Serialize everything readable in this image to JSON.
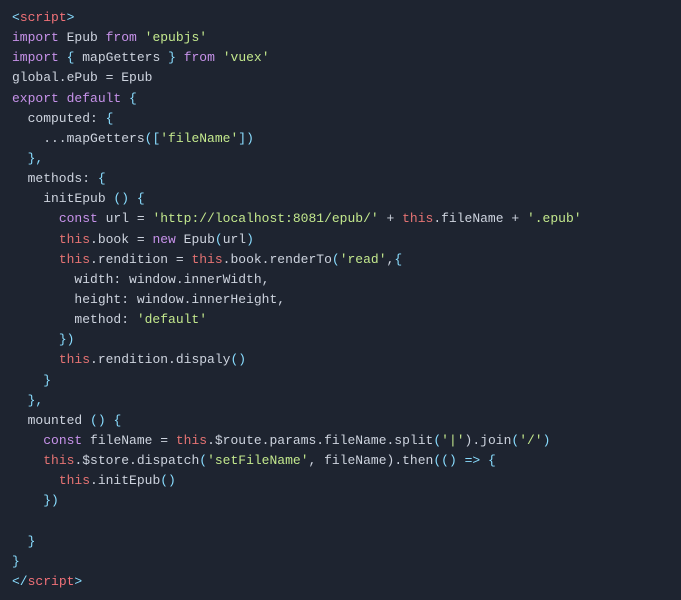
{
  "code": {
    "lines": [
      {
        "tokens": [
          {
            "t": "tag-bracket",
            "v": "<"
          },
          {
            "t": "tag",
            "v": "script"
          },
          {
            "t": "tag-bracket",
            "v": ">"
          }
        ]
      },
      {
        "tokens": [
          {
            "t": "kw",
            "v": "import"
          },
          {
            "t": "plain",
            "v": " Epub "
          },
          {
            "t": "kw",
            "v": "from"
          },
          {
            "t": "plain",
            "v": " "
          },
          {
            "t": "str",
            "v": "'epubjs'"
          }
        ]
      },
      {
        "tokens": [
          {
            "t": "kw",
            "v": "import"
          },
          {
            "t": "plain",
            "v": " "
          },
          {
            "t": "punct",
            "v": "{"
          },
          {
            "t": "plain",
            "v": " mapGetters "
          },
          {
            "t": "punct",
            "v": "}"
          },
          {
            "t": "plain",
            "v": " "
          },
          {
            "t": "kw",
            "v": "from"
          },
          {
            "t": "plain",
            "v": " "
          },
          {
            "t": "str",
            "v": "'vuex'"
          }
        ]
      },
      {
        "tokens": [
          {
            "t": "plain",
            "v": "global.ePub = Epub"
          }
        ]
      },
      {
        "tokens": [
          {
            "t": "kw",
            "v": "export"
          },
          {
            "t": "plain",
            "v": " "
          },
          {
            "t": "kw",
            "v": "default"
          },
          {
            "t": "plain",
            "v": " "
          },
          {
            "t": "punct",
            "v": "{"
          }
        ]
      },
      {
        "tokens": [
          {
            "t": "plain",
            "v": "  computed: "
          },
          {
            "t": "punct",
            "v": "{"
          }
        ]
      },
      {
        "tokens": [
          {
            "t": "plain",
            "v": "    ...mapGetters"
          },
          {
            "t": "punct",
            "v": "("
          },
          {
            "t": "punct",
            "v": "["
          },
          {
            "t": "str",
            "v": "'fileName'"
          },
          {
            "t": "punct",
            "v": "]"
          },
          {
            "t": "punct",
            "v": ")"
          }
        ]
      },
      {
        "tokens": [
          {
            "t": "plain",
            "v": "  "
          },
          {
            "t": "punct",
            "v": "},"
          }
        ]
      },
      {
        "tokens": [
          {
            "t": "plain",
            "v": "  methods: "
          },
          {
            "t": "punct",
            "v": "{"
          }
        ]
      },
      {
        "tokens": [
          {
            "t": "plain",
            "v": "    initEpub "
          },
          {
            "t": "punct",
            "v": "()"
          },
          {
            "t": "plain",
            "v": " "
          },
          {
            "t": "punct",
            "v": "{"
          }
        ]
      },
      {
        "tokens": [
          {
            "t": "plain",
            "v": "      "
          },
          {
            "t": "kw",
            "v": "const"
          },
          {
            "t": "plain",
            "v": " url = "
          },
          {
            "t": "str",
            "v": "'http://localhost:8081/epub/'"
          },
          {
            "t": "plain",
            "v": " + "
          },
          {
            "t": "this-kw",
            "v": "this"
          },
          {
            "t": "plain",
            "v": ".fileName + "
          },
          {
            "t": "str",
            "v": "'.epub'"
          }
        ]
      },
      {
        "tokens": [
          {
            "t": "plain",
            "v": "      "
          },
          {
            "t": "this-kw",
            "v": "this"
          },
          {
            "t": "plain",
            "v": ".book = "
          },
          {
            "t": "kw",
            "v": "new"
          },
          {
            "t": "plain",
            "v": " Epub"
          },
          {
            "t": "punct",
            "v": "("
          },
          {
            "t": "plain",
            "v": "url"
          },
          {
            "t": "punct",
            "v": ")"
          }
        ]
      },
      {
        "tokens": [
          {
            "t": "plain",
            "v": "      "
          },
          {
            "t": "this-kw",
            "v": "this"
          },
          {
            "t": "plain",
            "v": ".rendition = "
          },
          {
            "t": "this-kw",
            "v": "this"
          },
          {
            "t": "plain",
            "v": ".book.renderTo"
          },
          {
            "t": "punct",
            "v": "("
          },
          {
            "t": "str",
            "v": "'read'"
          },
          {
            "t": "plain",
            "v": ","
          },
          {
            "t": "punct",
            "v": "{"
          }
        ]
      },
      {
        "tokens": [
          {
            "t": "plain",
            "v": "        width: window.innerWidth,"
          }
        ]
      },
      {
        "tokens": [
          {
            "t": "plain",
            "v": "        height: window.innerHeight,"
          }
        ]
      },
      {
        "tokens": [
          {
            "t": "plain",
            "v": "        method: "
          },
          {
            "t": "str",
            "v": "'default'"
          }
        ]
      },
      {
        "tokens": [
          {
            "t": "plain",
            "v": "      "
          },
          {
            "t": "punct",
            "v": "})"
          }
        ]
      },
      {
        "tokens": [
          {
            "t": "plain",
            "v": "      "
          },
          {
            "t": "this-kw",
            "v": "this"
          },
          {
            "t": "plain",
            "v": ".rendition.dispaly"
          },
          {
            "t": "punct",
            "v": "()"
          }
        ]
      },
      {
        "tokens": [
          {
            "t": "plain",
            "v": "    "
          },
          {
            "t": "punct",
            "v": "}"
          }
        ]
      },
      {
        "tokens": [
          {
            "t": "plain",
            "v": "  "
          },
          {
            "t": "punct",
            "v": "},"
          }
        ]
      },
      {
        "tokens": [
          {
            "t": "plain",
            "v": "  mounted "
          },
          {
            "t": "punct",
            "v": "()"
          },
          {
            "t": "plain",
            "v": " "
          },
          {
            "t": "punct",
            "v": "{"
          }
        ]
      },
      {
        "tokens": [
          {
            "t": "plain",
            "v": "    "
          },
          {
            "t": "kw",
            "v": "const"
          },
          {
            "t": "plain",
            "v": " fileName = "
          },
          {
            "t": "this-kw",
            "v": "this"
          },
          {
            "t": "plain",
            "v": ".$route.params.fileName.split"
          },
          {
            "t": "punct",
            "v": "("
          },
          {
            "t": "str",
            "v": "'|'"
          },
          {
            "t": "plain",
            "v": ")"
          },
          {
            "t": "plain",
            "v": ".join"
          },
          {
            "t": "punct",
            "v": "("
          },
          {
            "t": "str",
            "v": "'/'"
          },
          {
            "t": "punct",
            "v": ")"
          }
        ]
      },
      {
        "tokens": [
          {
            "t": "plain",
            "v": "    "
          },
          {
            "t": "this-kw",
            "v": "this"
          },
          {
            "t": "plain",
            "v": ".$store.dispatch"
          },
          {
            "t": "punct",
            "v": "("
          },
          {
            "t": "str",
            "v": "'setFileName'"
          },
          {
            "t": "plain",
            "v": ", fileName)"
          },
          {
            "t": "plain",
            "v": ".then"
          },
          {
            "t": "punct",
            "v": "("
          },
          {
            "t": "punct",
            "v": "()"
          },
          {
            "t": "plain",
            "v": " "
          },
          {
            "t": "punct",
            "v": "=>"
          },
          {
            "t": "plain",
            "v": " "
          },
          {
            "t": "punct",
            "v": "{"
          }
        ]
      },
      {
        "tokens": [
          {
            "t": "plain",
            "v": "      "
          },
          {
            "t": "this-kw",
            "v": "this"
          },
          {
            "t": "plain",
            "v": ".initEpub"
          },
          {
            "t": "punct",
            "v": "()"
          }
        ]
      },
      {
        "tokens": [
          {
            "t": "plain",
            "v": "    "
          },
          {
            "t": "punct",
            "v": "})"
          }
        ]
      },
      {
        "tokens": []
      },
      {
        "tokens": [
          {
            "t": "plain",
            "v": "  "
          },
          {
            "t": "punct",
            "v": "}"
          }
        ]
      },
      {
        "tokens": [
          {
            "t": "punct",
            "v": "}"
          }
        ]
      },
      {
        "tokens": [
          {
            "t": "tag-bracket",
            "v": "</"
          },
          {
            "t": "tag",
            "v": "script"
          },
          {
            "t": "tag-bracket",
            "v": ">"
          }
        ]
      }
    ]
  }
}
